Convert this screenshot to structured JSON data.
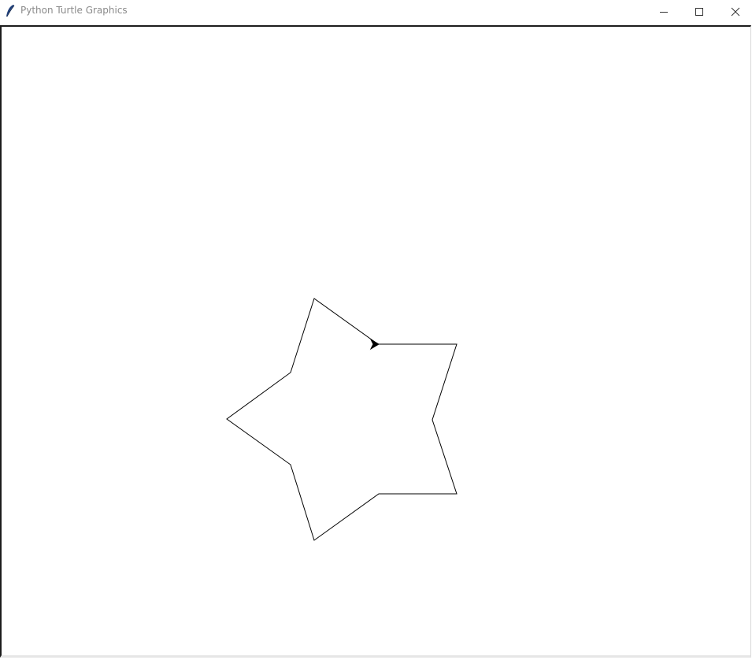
{
  "window": {
    "title": "Python Turtle Graphics",
    "icons": {
      "app": "feather-icon",
      "minimize": "minimize-icon",
      "maximize": "maximize-icon",
      "close": "close-icon"
    }
  },
  "canvas": {
    "background": "#ffffff",
    "pen_color": "#000000",
    "turtle_heading": "east",
    "shape": "five-pointed star outline"
  }
}
